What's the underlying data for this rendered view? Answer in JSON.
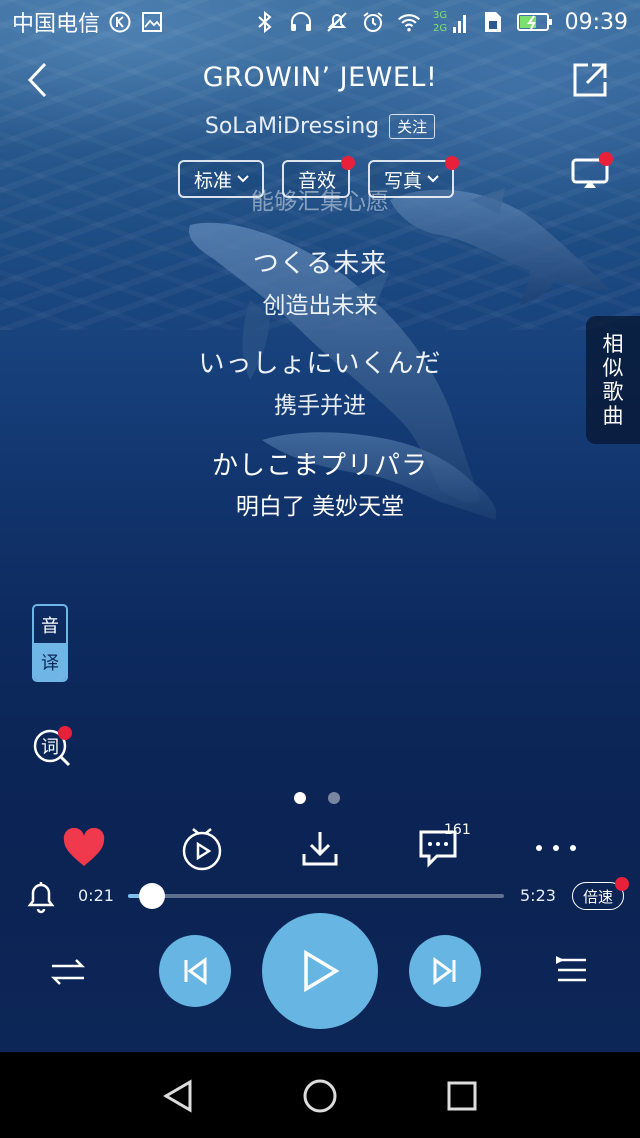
{
  "status_bar": {
    "carrier": "中国电信",
    "network_badges": [
      "3G",
      "2G"
    ],
    "time": "09:39",
    "icons": [
      "k-circle-icon",
      "image-icon",
      "bluetooth-icon",
      "headphones-icon",
      "mute-icon",
      "alarm-icon",
      "wifi-icon",
      "signal-icon",
      "sim-icon",
      "battery-charging-icon"
    ]
  },
  "header": {
    "title": "GROWIN’ JEWEL!",
    "artist": "SoLaMiDressing",
    "follow_label": "关注",
    "chips": [
      {
        "label": "标准",
        "has_dot": false
      },
      {
        "label": "音效",
        "has_dot": true
      },
      {
        "label": "写真",
        "has_dot": true
      }
    ]
  },
  "lyrics": [
    {
      "text": "能够汇集心愿",
      "style": "faded"
    },
    {
      "text": "つくる未来",
      "style": "ja"
    },
    {
      "text": "创造出未来",
      "style": "zh"
    },
    {
      "text": "いっしょにいくんだ",
      "style": "ja"
    },
    {
      "text": "携手并进",
      "style": "zh"
    },
    {
      "text": "かしこまプリパラ",
      "style": "ja-bright"
    },
    {
      "text": "明白了 美妙天堂",
      "style": "zh-bright"
    }
  ],
  "similar_songs": {
    "chars": [
      "相",
      "似",
      "歌",
      "曲"
    ]
  },
  "translate_toggle": {
    "top": "音",
    "bottom": "译"
  },
  "lyric_search_label": "词",
  "actions": {
    "comment_count": "161",
    "accent": "#f0394c"
  },
  "progress": {
    "current": "0:21",
    "total": "5:23",
    "fraction": 0.065,
    "speed_label": "倍速"
  },
  "colors": {
    "accent_blue": "#66b5e2",
    "heart_red": "#f0394c",
    "dot_red": "#e8203a"
  }
}
